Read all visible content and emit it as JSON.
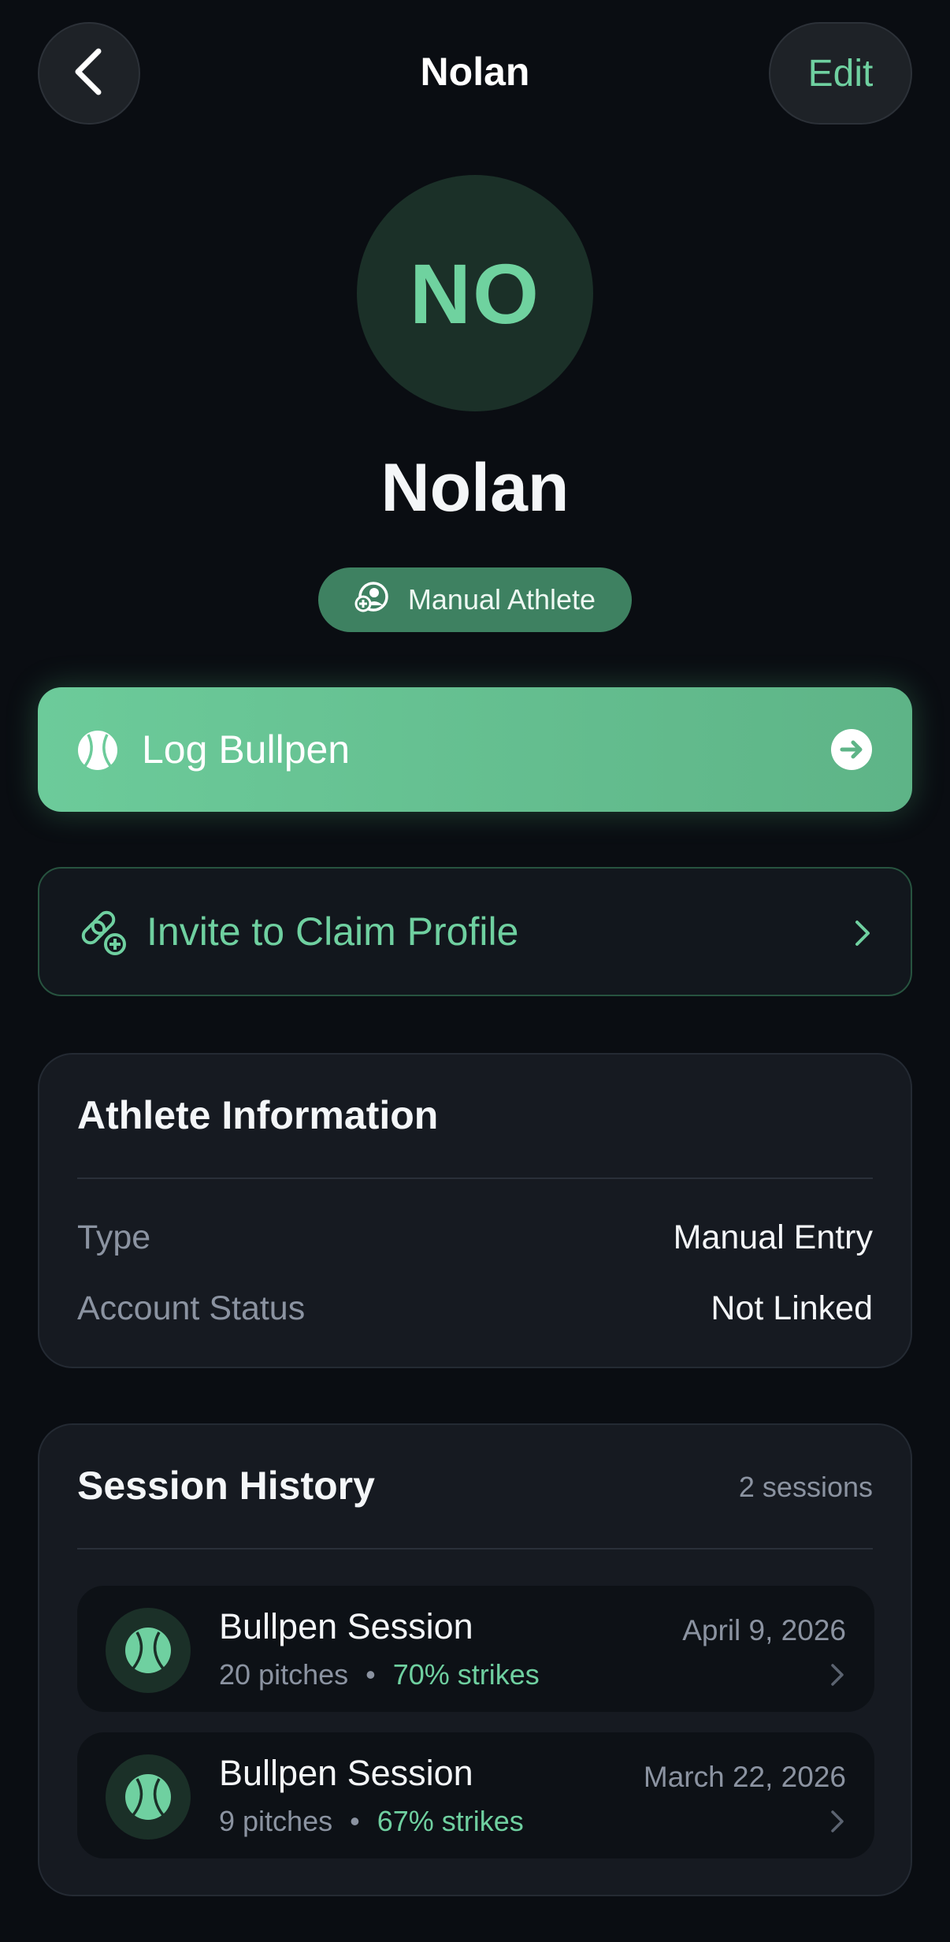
{
  "header": {
    "title": "Nolan",
    "back_icon": "chevron-left-icon",
    "edit_label": "Edit"
  },
  "profile": {
    "initials": "NO",
    "name": "Nolan",
    "badge_label": "Manual Athlete",
    "badge_icon": "user-plus-icon"
  },
  "actions": {
    "log_bullpen_label": "Log Bullpen",
    "log_bullpen_icon": "baseball-icon",
    "log_bullpen_arrow_icon": "arrow-right-circle-icon",
    "invite_label": "Invite to Claim Profile",
    "invite_icon": "link-plus-icon"
  },
  "athlete_info": {
    "title": "Athlete Information",
    "rows": [
      {
        "label": "Type",
        "value": "Manual Entry"
      },
      {
        "label": "Account Status",
        "value": "Not Linked"
      }
    ]
  },
  "session_history": {
    "title": "Session History",
    "count_label": "2 sessions",
    "sessions": [
      {
        "title": "Bullpen Session",
        "pitches": "20 pitches",
        "separator": "•",
        "strikes": "70% strikes",
        "date": "April 9, 2026"
      },
      {
        "title": "Bullpen Session",
        "pitches": "9 pitches",
        "separator": "•",
        "strikes": "67% strikes",
        "date": "March 22, 2026"
      }
    ]
  },
  "colors": {
    "background": "#0a0d12",
    "accent": "#6fd0a0",
    "card": "#161a21",
    "badge": "#3e8161"
  }
}
